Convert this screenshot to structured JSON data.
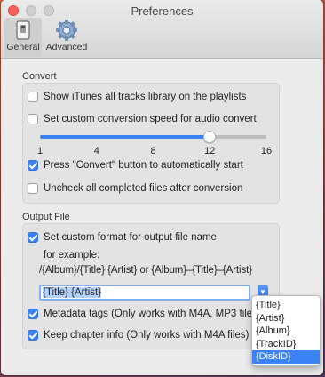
{
  "window": {
    "title": "Preferences"
  },
  "toolbar": {
    "general_label": "General",
    "advanced_label": "Advanced",
    "general_icon": "switch-icon",
    "advanced_icon": "gear-icon"
  },
  "convert": {
    "section_title": "Convert",
    "show_itunes_label": "Show iTunes all tracks library on the playlists",
    "show_itunes_checked": false,
    "custom_speed_label": "Set custom conversion speed for audio convert",
    "custom_speed_checked": false,
    "speed_ticks": [
      "1",
      "4",
      "8",
      "12",
      "16"
    ],
    "speed_value": 12,
    "press_convert_label": "Press \"Convert\" button to automatically start",
    "press_convert_checked": true,
    "uncheck_label": "Uncheck all completed files after conversion",
    "uncheck_checked": false
  },
  "output": {
    "section_title": "Output File",
    "custom_format_label": "Set custom format for output file name",
    "custom_format_checked": true,
    "example_label": "for example:",
    "example_value": "/{Album}/{Title} {Artist} or {Album}–{Title}–{Artist}",
    "format_value": "{Title} {Artist}",
    "metadata_label": "Metadata tags (Only works with M4A, MP3 files)",
    "metadata_checked": true,
    "chapter_label": "Keep chapter info (Only works with M4A files)",
    "chapter_checked": true
  },
  "token_menu": {
    "items": [
      "{Title}",
      "{Artist}",
      "{Album}",
      "{TrackID}",
      "{DiskID}"
    ],
    "selected": "{DiskID}"
  },
  "colors": {
    "accent": "#3b82f6",
    "close": "#fc605c"
  }
}
